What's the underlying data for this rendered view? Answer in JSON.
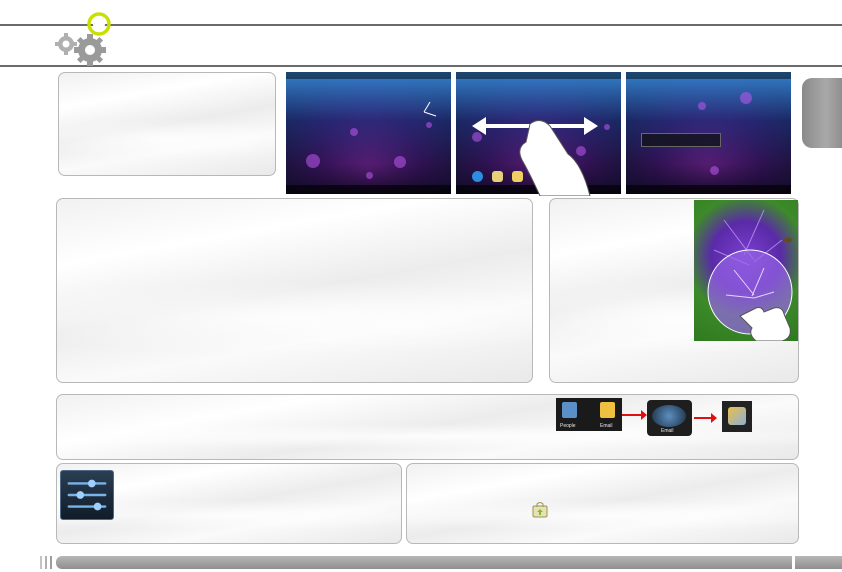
{
  "header": {
    "icon": "settings-gears-icon",
    "accent_color": "#c8e000"
  },
  "screenshots": {
    "swipe_hint_icon": "hand-swipe-icon",
    "lock_screen_icon": "lock-ring-icon"
  },
  "photo": {
    "subject_icon": "allium-flower-photo",
    "gesture_icon": "pinch-hand-icon"
  },
  "apps_strip": {
    "group_before": [
      {
        "label": "People"
      },
      {
        "label": "Email"
      }
    ],
    "folder_label": "Email",
    "arrow_color": "#e01010"
  },
  "settings": {
    "icon": "settings-sliders-icon"
  },
  "market": {
    "icon": "market-bag-icon"
  }
}
